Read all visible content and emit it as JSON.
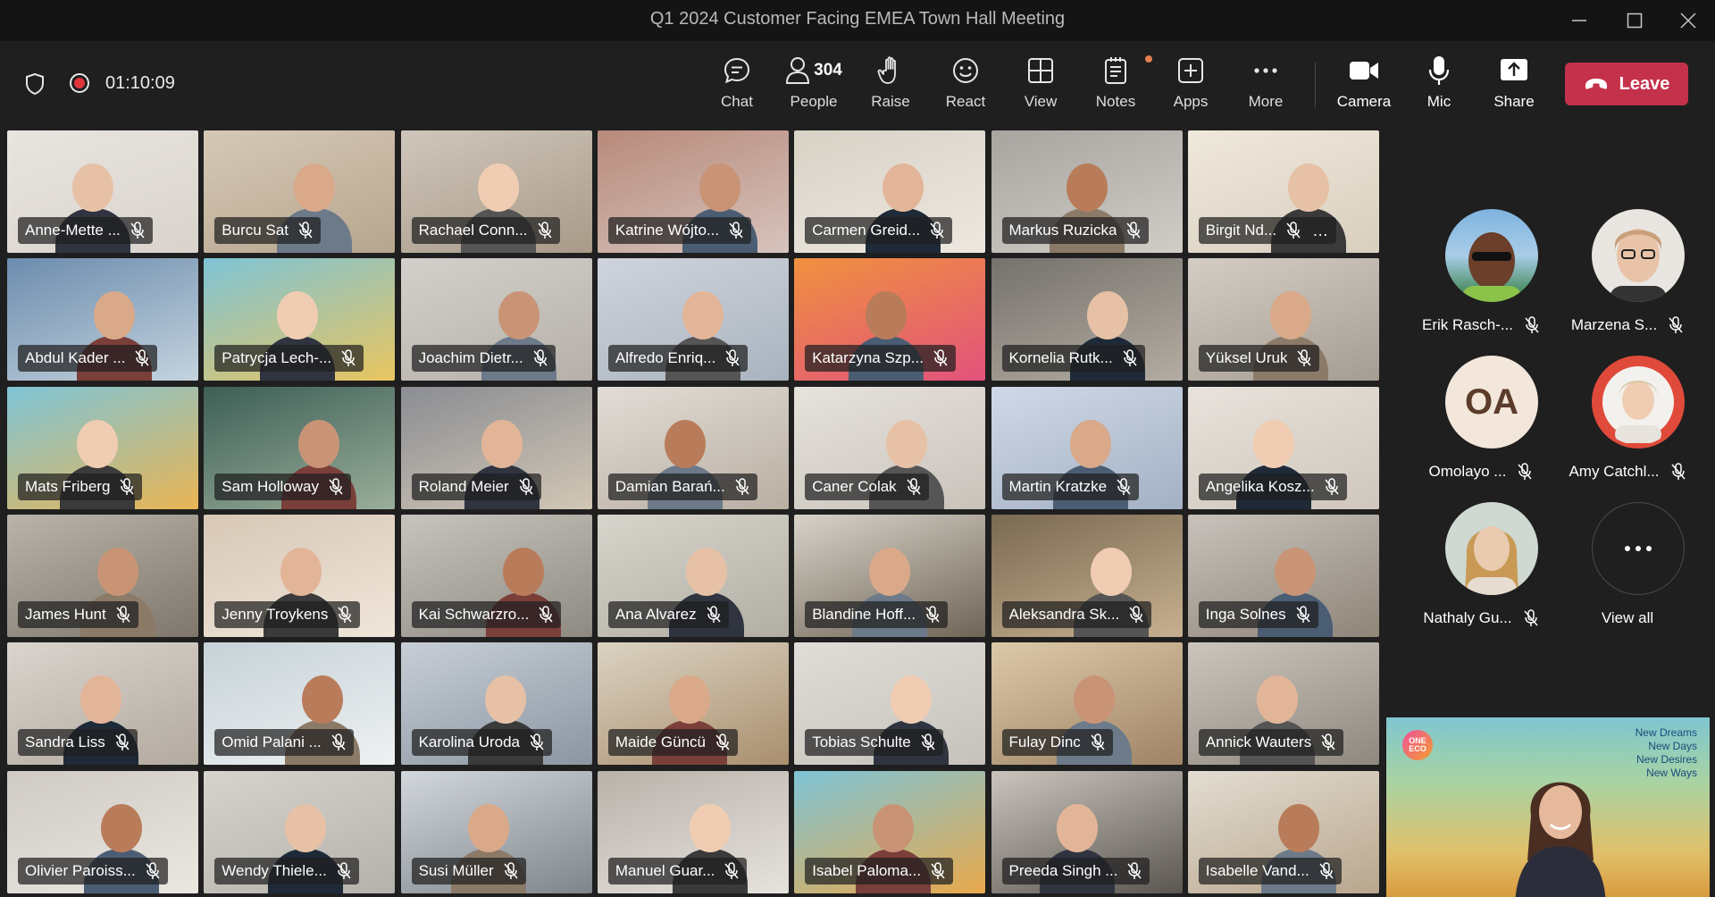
{
  "window": {
    "title": "Q1 2024 Customer Facing EMEA Town Hall Meeting",
    "controls": [
      "minimize-icon",
      "maximize-icon",
      "close-icon"
    ]
  },
  "meeting": {
    "timer": "01:10:09",
    "recording": true
  },
  "toolbar": {
    "chat": "Chat",
    "people": "People",
    "people_count": "304",
    "raise": "Raise",
    "react": "React",
    "view": "View",
    "notes": "Notes",
    "apps": "Apps",
    "more": "More",
    "camera": "Camera",
    "mic": "Mic",
    "share": "Share",
    "leave": "Leave"
  },
  "grid": {
    "rows": [
      [
        "Anne-Mette ...",
        "Burcu Sat",
        "Rachael Conn...",
        "Katrine Wójto...",
        "Carmen Greid...",
        "Markus Ruzicka",
        "Birgit Nd..."
      ],
      [
        "Abdul Kader ...",
        "Patrycja Lech-...",
        "Joachim Dietr...",
        "Alfredo Enriq...",
        "Katarzyna Szp...",
        "Kornelia Rutk...",
        "Yüksel Uruk"
      ],
      [
        "Mats Friberg",
        "Sam Holloway",
        "Roland Meier",
        "Damian Barań...",
        "Caner Colak",
        "Martin Kratzke",
        "Angelika Kosz..."
      ],
      [
        "James Hunt",
        "Jenny Troykens",
        "Kai Schwarzro...",
        "Ana Alvarez",
        "Blandine Hoff...",
        "Aleksandra Sk...",
        "Inga Solnes"
      ],
      [
        "Sandra Liss",
        "Omid Palani ...",
        "Karolina Uroda",
        "Maide Güncü",
        "Tobias Schulte",
        "Fulay Dinc",
        "Annick Wauters"
      ],
      [
        "Olivier Paroiss...",
        "Wendy Thiele...",
        "Susi Müller",
        "Manuel Guar...",
        "Isabel Paloma...",
        "Preeda Singh ...",
        "Isabelle Vand..."
      ]
    ]
  },
  "sidebar": {
    "participants": [
      {
        "name": "Erik Rasch-...",
        "initials": ""
      },
      {
        "name": "Marzena S...",
        "initials": ""
      },
      {
        "name": "Omolayo ...",
        "initials": "OA"
      },
      {
        "name": "Amy Catchl...",
        "initials": ""
      },
      {
        "name": "Nathaly Gu...",
        "initials": ""
      }
    ],
    "view_all": "View all"
  },
  "featured": {
    "logo": "ONE ECO",
    "slogan": [
      "New Dreams",
      "New Days",
      "New Desires",
      "New Ways"
    ]
  },
  "colors": {
    "leave": "#c4314b",
    "recording": "#e0353b",
    "background": "#1f1f1f"
  }
}
